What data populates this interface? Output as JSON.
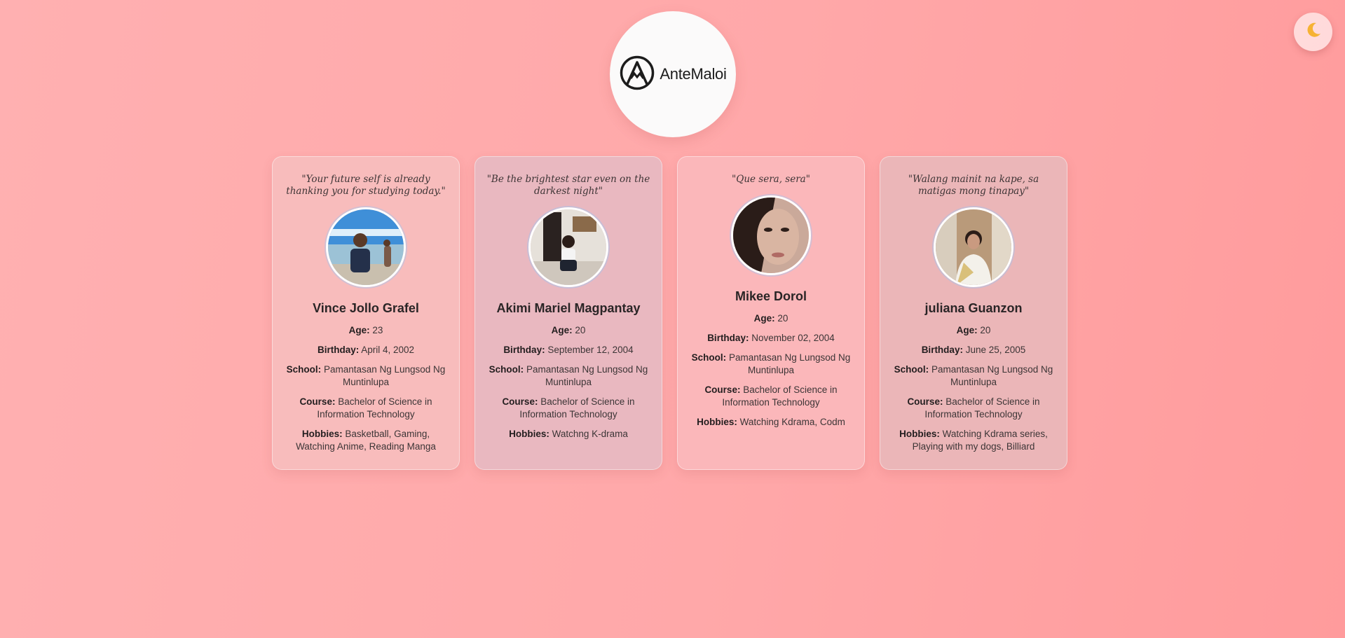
{
  "brand": {
    "logo_text": "AnteMaloi",
    "logo_icon": "a-monogram-circle-icon"
  },
  "theme_toggle": {
    "icon": "crescent-moon-icon"
  },
  "field_labels": {
    "age": "Age:",
    "birthday": "Birthday:",
    "school": "School:",
    "course": "Course:",
    "hobbies": "Hobbies:"
  },
  "profiles": [
    {
      "quote": "\"Your future self is already thanking you for studying today.\"",
      "name": "Vince Jollo Grafel",
      "age": "23",
      "birthday": "April 4, 2002",
      "school": "Pamantasan Ng Lungsod Ng Muntinlupa",
      "course": "Bachelor of Science in Information Technology",
      "hobbies": "Basketball, Gaming, Watching Anime, Reading Manga"
    },
    {
      "quote": "\"Be the brightest star even on the darkest night\"",
      "name": "Akimi Mariel Magpantay",
      "age": "20",
      "birthday": "September 12, 2004",
      "school": "Pamantasan Ng Lungsod Ng Muntinlupa",
      "course": "Bachelor of Science in Information Technology",
      "hobbies": "Watchng K-drama"
    },
    {
      "quote": "\"Que sera, sera\"",
      "name": "Mikee Dorol",
      "age": "20",
      "birthday": "November 02, 2004",
      "school": "Pamantasan Ng Lungsod Ng Muntinlupa",
      "course": "Bachelor of Science in Information Technology",
      "hobbies": "Watching Kdrama, Codm"
    },
    {
      "quote": "\"Walang mainit na kape, sa matigas mong tinapay\"",
      "name": "juliana Guanzon",
      "age": "20",
      "birthday": "June 25, 2005",
      "school": "Pamantasan Ng Lungsod Ng Muntinlupa",
      "course": "Bachelor of Science in Information Technology",
      "hobbies": "Watching Kdrama series, Playing with my dogs, Billiard"
    }
  ],
  "colors": {
    "background": "#ffa8a9",
    "card_1": "#f8bcbc",
    "card_2": "#e9b8c0",
    "card_3": "#fbb7ba",
    "card_4": "#ebb6b8",
    "logo_bg": "#fbfafa"
  }
}
